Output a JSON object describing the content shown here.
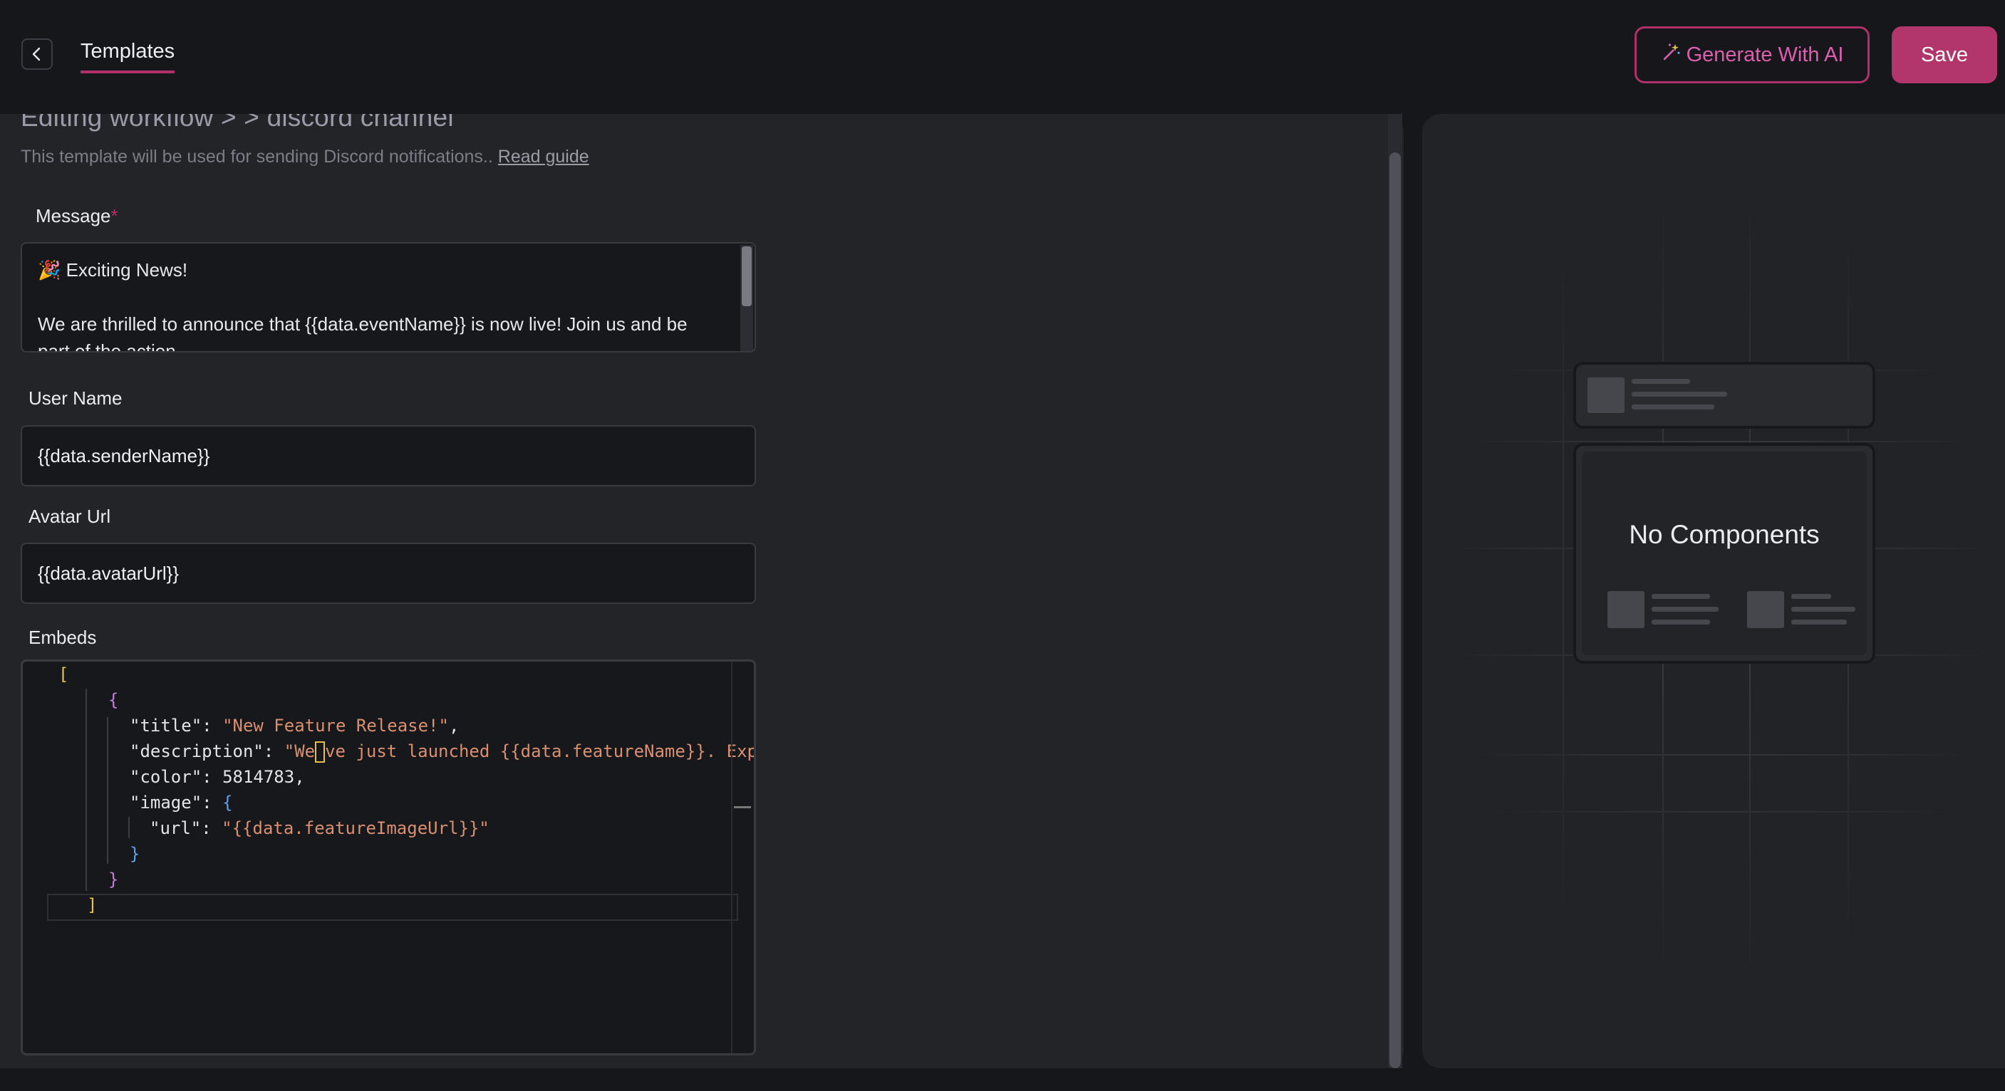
{
  "header": {
    "tab_label": "Templates",
    "generate_ai_label": "Generate With AI",
    "generate_ai_icon": "sparkle-wand-icon",
    "save_label": "Save"
  },
  "editor": {
    "breadcrumb": "Editing workflow >  > discord channel",
    "subtitle": "This template will be used for sending Discord notifications..",
    "read_guide": "Read guide",
    "message": {
      "label": "Message",
      "required_mark": "*",
      "line1": "🎉 Exciting News!",
      "line2": "  We are thrilled to announce that {{data.eventName}} is now live! Join us and be part of the action."
    },
    "user_name": {
      "label": "User Name",
      "value": "{{data.senderName}}"
    },
    "avatar_url": {
      "label": "Avatar Url",
      "value": "{{data.avatarUrl}}"
    },
    "embeds": {
      "label": "Embeds",
      "title_key": "\"title\"",
      "title_val": "\"New Feature Release!\"",
      "desc_key": "\"description\"",
      "desc_val_a": "\"We",
      "desc_val_b": "ve just launched {{data.featureName}}. Exp",
      "color_key": "\"color\"",
      "color_val": "5814783",
      "image_key": "\"image\"",
      "url_key": "\"url\"",
      "url_val": "\"{{data.featureImageUrl}}\""
    }
  },
  "preview": {
    "empty_text": "No Components"
  },
  "colors": {
    "accent": "#b0306a",
    "save_bg": "#b2366b",
    "ai_text": "#de5fb0"
  }
}
